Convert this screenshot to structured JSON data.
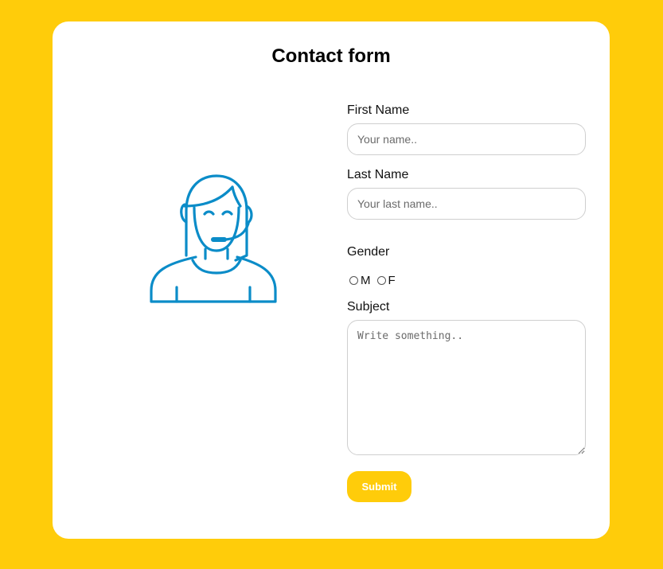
{
  "page": {
    "title": "Contact form"
  },
  "illustration": {
    "icon": "support-agent-icon",
    "color": "#0B8CC8"
  },
  "form": {
    "first_name": {
      "label": "First Name",
      "placeholder": "Your name.."
    },
    "last_name": {
      "label": "Last Name",
      "placeholder": "Your last name.."
    },
    "gender": {
      "label": "Gender",
      "options": [
        "M",
        "F"
      ]
    },
    "subject": {
      "label": "Subject",
      "placeholder": "Write something.."
    },
    "submit_label": "Submit"
  },
  "colors": {
    "background": "#FFCC0A",
    "card": "#FFFFFF",
    "accent": "#FFCC0A"
  }
}
